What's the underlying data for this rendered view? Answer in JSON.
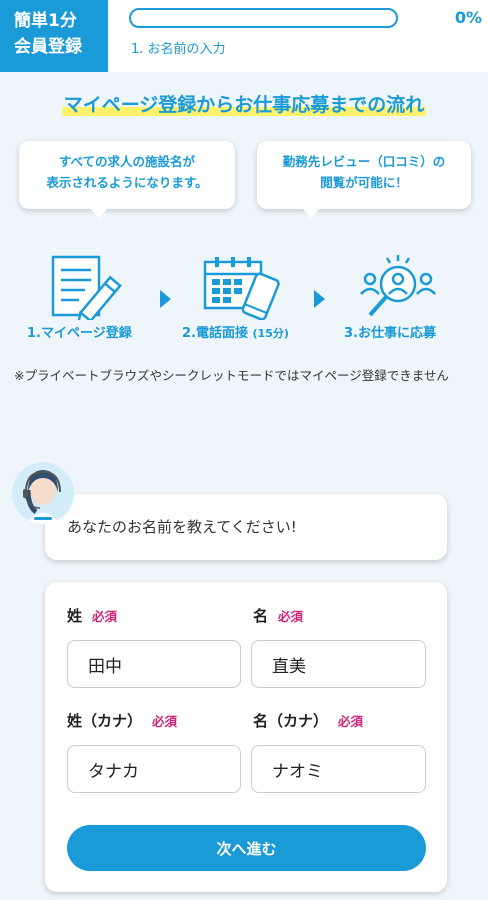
{
  "colors": {
    "brand": "#1a9ad7",
    "highlight": "#fff26b",
    "required": "#d1237a"
  },
  "header": {
    "badge_line1": "簡単1分",
    "badge_line2": "会員登録",
    "progress_percent": 0,
    "progress_label": "0%",
    "step_text": "1. お名前の入力"
  },
  "flow": {
    "title": "マイページ登録からお仕事応募までの流れ",
    "bubble_left": [
      "すべての求人の施設名が",
      "表示されるようになります。"
    ],
    "bubble_right": [
      "勤務先レビュー（口コミ）の",
      "閲覧が可能に！"
    ],
    "steps": [
      {
        "label": "1.マイページ登録",
        "icon": "document-pencil-icon"
      },
      {
        "label": "2.電話面接",
        "sub": "(15分)",
        "icon": "calendar-phone-icon"
      },
      {
        "label": "3.お仕事に応募",
        "icon": "people-magnifier-icon"
      }
    ],
    "note": "※プライベートブラウズやシークレットモードではマイページ登録できません"
  },
  "chat": {
    "avatar_icon": "operator-avatar-icon",
    "question": "あなたのお名前を教えてください!"
  },
  "form": {
    "required_text": "必須",
    "fields": {
      "last_name": {
        "label": "姓",
        "value": "田中"
      },
      "first_name": {
        "label": "名",
        "value": "直美"
      },
      "last_name_kana": {
        "label": "姓（カナ）",
        "value": "タナカ"
      },
      "first_name_kana": {
        "label": "名（カナ）",
        "value": "ナオミ"
      }
    },
    "submit_label": "次へ進む"
  }
}
